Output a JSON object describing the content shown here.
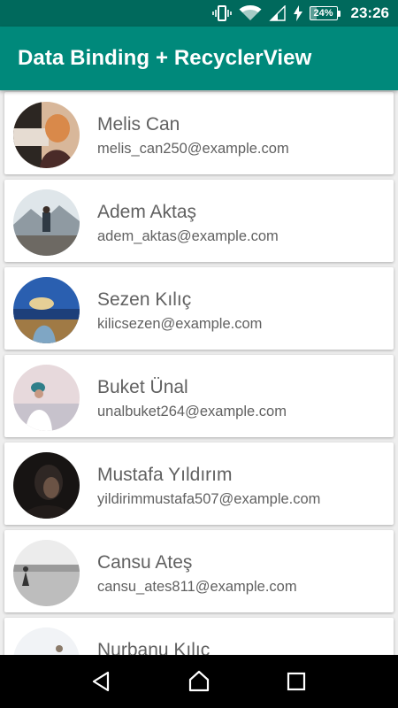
{
  "status_bar": {
    "time": "23:26",
    "battery_level": "24%",
    "battery_fraction": 0.24,
    "icons": [
      "vibrate-icon",
      "wifi-icon",
      "cell-signal-icon",
      "charging-bolt-icon",
      "battery-icon"
    ]
  },
  "app_bar": {
    "title": "Data Binding + RecyclerView",
    "color": "#00897b",
    "status_color": "#00695c"
  },
  "contacts": [
    {
      "name": "Melis Can",
      "email": "melis_can250@example.com"
    },
    {
      "name": "Adem Aktaş",
      "email": "adem_aktas@example.com"
    },
    {
      "name": "Sezen Kılıç",
      "email": "kilicsezen@example.com"
    },
    {
      "name": "Buket Ünal",
      "email": "unalbuket264@example.com"
    },
    {
      "name": "Mustafa Yıldırım",
      "email": "yildirimmustafa507@example.com"
    },
    {
      "name": "Cansu Ateş",
      "email": "cansu_ates811@example.com"
    },
    {
      "name": "Nurbanu Kılıç",
      "email": ""
    }
  ],
  "nav_bar": {
    "buttons": [
      "back-icon",
      "home-icon",
      "recents-icon"
    ]
  }
}
